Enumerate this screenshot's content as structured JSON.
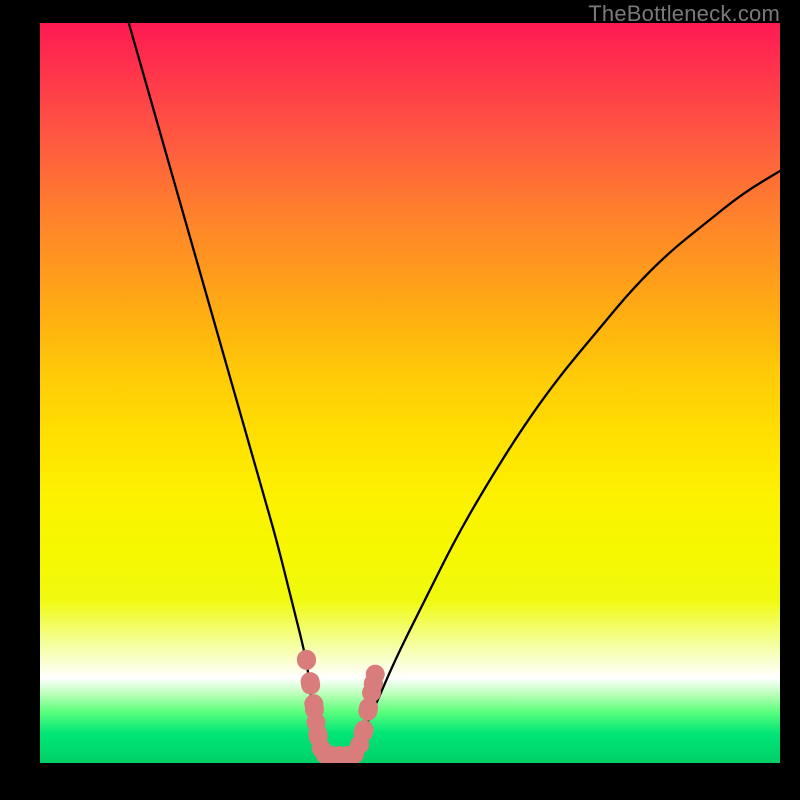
{
  "watermark": "TheBottleneck.com",
  "chart_data": {
    "type": "line",
    "title": "",
    "xlabel": "",
    "ylabel": "",
    "xlim": [
      0,
      100
    ],
    "ylim": [
      0,
      100
    ],
    "series": [
      {
        "name": "bottleneck-curve",
        "x": [
          12,
          16,
          20,
          24,
          28,
          30,
          32,
          34,
          36,
          36.5,
          37,
          38,
          39,
          40,
          41,
          42,
          43,
          45,
          48,
          52,
          56,
          60,
          65,
          70,
          75,
          80,
          85,
          90,
          95,
          100
        ],
        "values": [
          100,
          86,
          72,
          58,
          44,
          37,
          30,
          22,
          14,
          10,
          6,
          3,
          1,
          0,
          0,
          1,
          3,
          7,
          14,
          22,
          30,
          37,
          45,
          52,
          58,
          64,
          69,
          73,
          77,
          80
        ]
      }
    ],
    "highlight": {
      "name": "optimal-range",
      "color": "#d87c7c",
      "points": [
        {
          "x": 36.0,
          "y": 14.0
        },
        {
          "x": 36.5,
          "y": 11.0
        },
        {
          "x": 37.0,
          "y": 8.0
        },
        {
          "x": 37.3,
          "y": 5.5
        },
        {
          "x": 37.6,
          "y": 3.5
        },
        {
          "x": 38.0,
          "y": 2.0
        },
        {
          "x": 38.5,
          "y": 1.2
        },
        {
          "x": 39.5,
          "y": 1.0
        },
        {
          "x": 40.5,
          "y": 1.0
        },
        {
          "x": 41.5,
          "y": 1.0
        },
        {
          "x": 42.5,
          "y": 1.2
        },
        {
          "x": 43.2,
          "y": 2.5
        },
        {
          "x": 43.8,
          "y": 4.5
        },
        {
          "x": 44.3,
          "y": 7.0
        },
        {
          "x": 44.8,
          "y": 9.5
        },
        {
          "x": 45.3,
          "y": 12.0
        }
      ]
    }
  }
}
